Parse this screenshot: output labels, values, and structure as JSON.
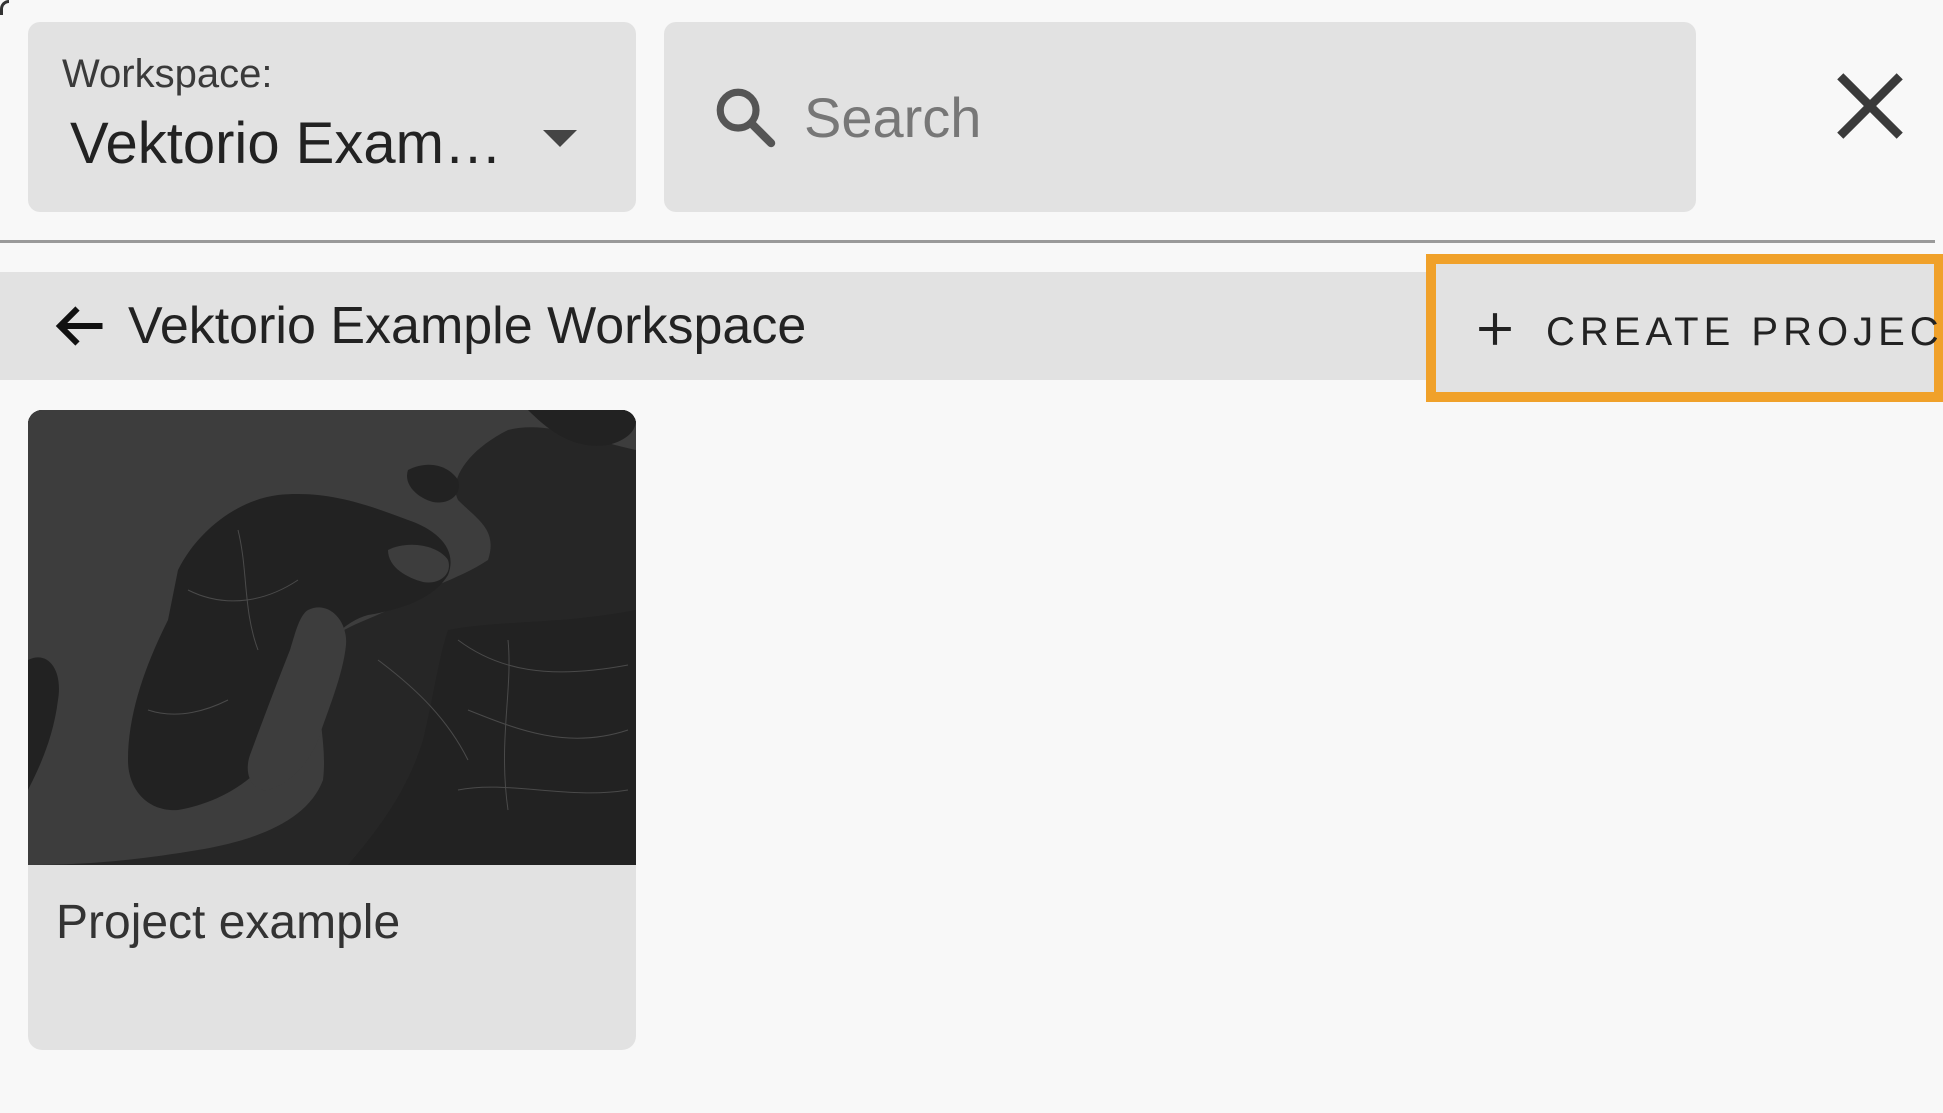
{
  "workspace_selector": {
    "label": "Workspace:",
    "value": "Vektorio Example Workspace"
  },
  "search": {
    "placeholder": "Search",
    "value": ""
  },
  "header": {
    "title": "Vektorio Example Workspace",
    "create_button_label": "CREATE PROJECT"
  },
  "projects": [
    {
      "name": "Project example",
      "thumbnail": "dark-map-of-northern-europe"
    }
  ],
  "colors": {
    "highlight": "#f0a12a",
    "panel": "#e2e2e2",
    "background": "#f8f8f8",
    "thumbnail_bg": "#262626"
  },
  "icons": {
    "dropdown": "chevron-down-icon",
    "search": "search-icon",
    "close": "close-icon",
    "back": "arrow-left-icon",
    "add": "plus-icon"
  }
}
